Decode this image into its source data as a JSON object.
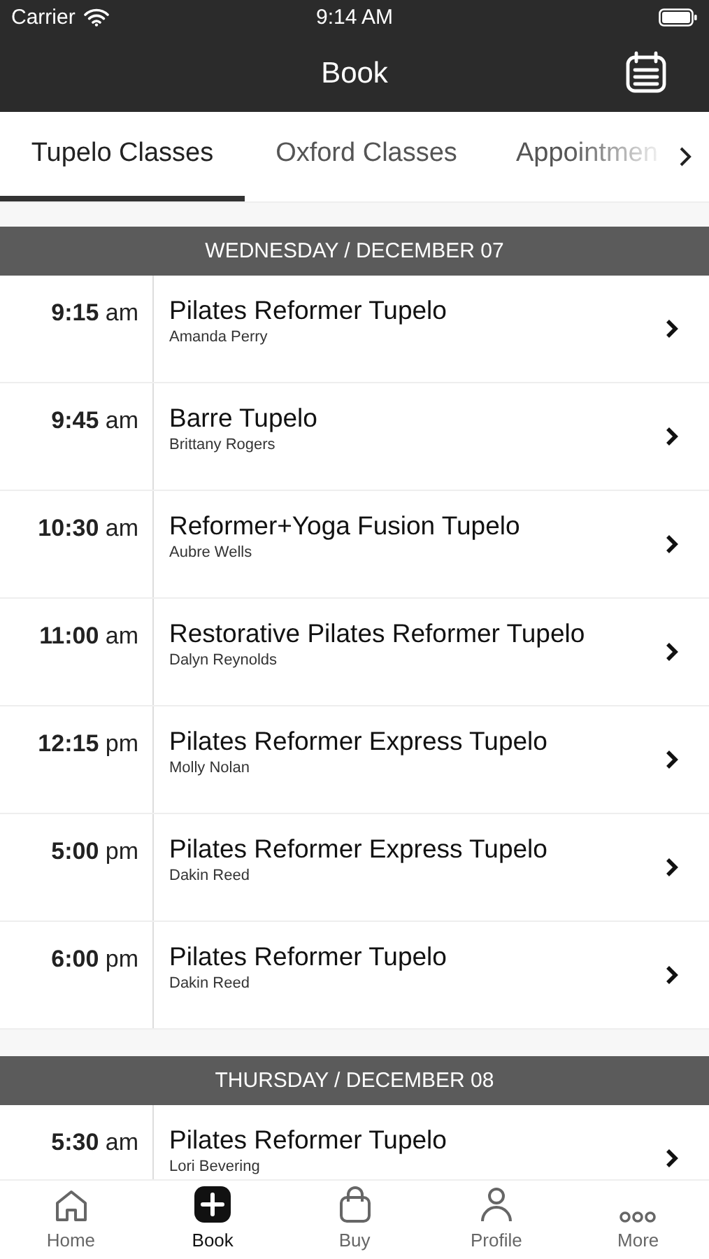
{
  "status_bar": {
    "carrier": "Carrier",
    "time": "9:14 AM"
  },
  "header": {
    "title": "Book"
  },
  "tabs": [
    {
      "label": "Tupelo Classes",
      "selected": true
    },
    {
      "label": "Oxford Classes",
      "selected": false
    },
    {
      "label": "Appointmen",
      "selected": false
    }
  ],
  "days": [
    {
      "heading": "WEDNESDAY / DECEMBER 07",
      "classes": [
        {
          "time": "**9:15** am",
          "name": "Pilates Reformer Tupelo",
          "instructor": "Amanda Perry"
        },
        {
          "time": "**9:45** am",
          "name": "Barre Tupelo",
          "instructor": "Brittany Rogers"
        },
        {
          "time": "**10:30** am",
          "name": "Reformer+Yoga Fusion Tupelo",
          "instructor": "Aubre Wells"
        },
        {
          "time": "**11:00** am",
          "name": "Restorative Pilates Reformer Tupelo",
          "instructor": "Dalyn Reynolds"
        },
        {
          "time": "**12:15** pm",
          "name": "Pilates Reformer Express Tupelo",
          "instructor": "Molly Nolan"
        },
        {
          "time": "**5:00** pm",
          "name": "Pilates Reformer Express Tupelo",
          "instructor": "Dakin Reed"
        },
        {
          "time": "**6:00** pm",
          "name": "Pilates Reformer Tupelo",
          "instructor": "Dakin Reed"
        }
      ]
    },
    {
      "heading": "THURSDAY / DECEMBER 08",
      "classes": [
        {
          "time": "**5:30** am",
          "name": "Pilates Reformer Tupelo",
          "instructor": "Lori Bevering"
        }
      ]
    }
  ],
  "tab_bar": [
    {
      "label": "Home",
      "selected": false
    },
    {
      "label": "Book",
      "selected": true
    },
    {
      "label": "Buy",
      "selected": false
    },
    {
      "label": "Profile",
      "selected": false
    },
    {
      "label": "More",
      "selected": false
    }
  ]
}
